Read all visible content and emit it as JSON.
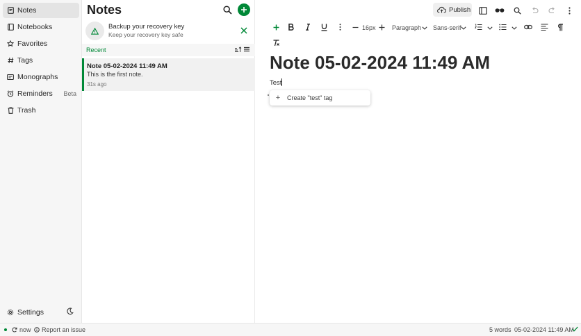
{
  "sidebar": {
    "items": [
      {
        "label": "Notes",
        "icon": "note-icon",
        "active": true
      },
      {
        "label": "Notebooks",
        "icon": "notebook-icon"
      },
      {
        "label": "Favorites",
        "icon": "star-icon"
      },
      {
        "label": "Tags",
        "icon": "hash-icon"
      },
      {
        "label": "Monographs",
        "icon": "monograph-icon"
      },
      {
        "label": "Reminders",
        "icon": "alarm-icon",
        "badge": "Beta"
      },
      {
        "label": "Trash",
        "icon": "trash-icon"
      }
    ],
    "settings_label": "Settings"
  },
  "notes_panel": {
    "title": "Notes",
    "backup": {
      "title": "Backup your recovery key",
      "subtitle": "Keep your recovery key safe"
    },
    "section_label": "Recent",
    "notes": [
      {
        "title": "Note 05-02-2024 11:49 AM",
        "snippet": "This is the first note.",
        "time": "31s ago"
      }
    ]
  },
  "editor": {
    "publish_label": "Publish",
    "font_size": "16px",
    "block_type": "Paragraph",
    "font_family": "Sans-serif",
    "title": "Note 05-02-2024 11:49 AM",
    "body_text": "Test",
    "suggestion_label": "Create \"test\" tag"
  },
  "statusbar": {
    "sync_time": "now",
    "report_label": "Report an issue",
    "word_count": "5 words",
    "timestamp": "05-02-2024 11:49 AM"
  },
  "colors": {
    "accent": "#008837",
    "sidebar_bg": "#f6f6f6",
    "selected_bg": "#e4e4e4"
  }
}
